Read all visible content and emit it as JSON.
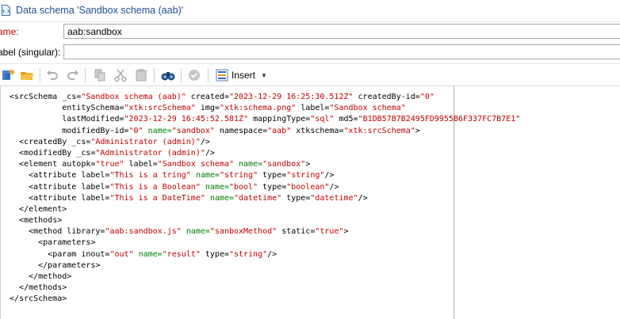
{
  "window": {
    "title": "Data schema 'Sandbox schema (aab)'"
  },
  "form": {
    "name_label": "ame:",
    "name_value": "aab:sandbox",
    "label_label": "abel (singular):",
    "label_value": ""
  },
  "toolbar": {
    "insert_label": "Insert",
    "icons": [
      "new-schema-icon",
      "open-folder-icon",
      "undo-icon",
      "redo-icon",
      "copy-icon",
      "cut-icon",
      "paste-icon",
      "find-icon",
      "check-icon",
      "insert-icon"
    ]
  },
  "colors": {
    "tag": "#000000",
    "attr": "#000000",
    "value": "#c00000",
    "name": "#008000",
    "title": "#1f4f8f",
    "required_label": "#c00000"
  },
  "editor": {
    "lines": [
      {
        "indent": "",
        "parts": [
          [
            "tag",
            "<srcSchema "
          ],
          [
            "attr",
            "_cs="
          ],
          [
            "val",
            "\"Sandbox schema (aab)\""
          ],
          [
            "attr",
            " created="
          ],
          [
            "val",
            "\"2023-12-29 16:25:30.512Z\""
          ],
          [
            "attr",
            " createdBy-id="
          ],
          [
            "val",
            "\"0\""
          ]
        ]
      },
      {
        "indent": "           ",
        "parts": [
          [
            "attr",
            "entitySchema="
          ],
          [
            "val",
            "\"xtk:srcSchema\""
          ],
          [
            "attr",
            " img="
          ],
          [
            "val",
            "\"xtk:schema.png\""
          ],
          [
            "attr",
            " label="
          ],
          [
            "val",
            "\"Sandbox schema\""
          ]
        ]
      },
      {
        "indent": "           ",
        "parts": [
          [
            "attr",
            "lastModified="
          ],
          [
            "val",
            "\"2023-12-29 16:45:52.581Z\""
          ],
          [
            "attr",
            " mappingType="
          ],
          [
            "val",
            "\"sql\""
          ],
          [
            "attr",
            " md5="
          ],
          [
            "val",
            "\"B1DB57B7B2495FD9955B6F337FC7B7E1\""
          ]
        ]
      },
      {
        "indent": "           ",
        "parts": [
          [
            "attr",
            "modifiedBy-id="
          ],
          [
            "val",
            "\"0\""
          ],
          [
            "name",
            " name="
          ],
          [
            "val",
            "\"sandbox\""
          ],
          [
            "attr",
            " namespace="
          ],
          [
            "val",
            "\"aab\""
          ],
          [
            "attr",
            " xtkschema="
          ],
          [
            "val",
            "\"xtk:srcSchema\""
          ],
          [
            "tag",
            ">"
          ]
        ]
      },
      {
        "indent": "  ",
        "parts": [
          [
            "tag",
            "<createdBy "
          ],
          [
            "attr",
            "_cs="
          ],
          [
            "val",
            "\"Administrator (admin)\""
          ],
          [
            "tag",
            "/>"
          ]
        ]
      },
      {
        "indent": "  ",
        "parts": [
          [
            "tag",
            "<modifiedBy "
          ],
          [
            "attr",
            "_cs="
          ],
          [
            "val",
            "\"Administrator (admin)\""
          ],
          [
            "tag",
            "/>"
          ]
        ]
      },
      {
        "indent": "  ",
        "parts": [
          [
            "tag",
            "<element "
          ],
          [
            "attr",
            "autopk="
          ],
          [
            "val",
            "\"true\""
          ],
          [
            "attr",
            " label="
          ],
          [
            "val",
            "\"Sandbox schema\""
          ],
          [
            "name",
            " name="
          ],
          [
            "val",
            "\"sandbox\""
          ],
          [
            "tag",
            ">"
          ]
        ]
      },
      {
        "indent": "    ",
        "parts": [
          [
            "tag",
            "<attribute "
          ],
          [
            "attr",
            "label="
          ],
          [
            "val",
            "\"This is a tring\""
          ],
          [
            "name",
            " name="
          ],
          [
            "val",
            "\"string\""
          ],
          [
            "attr",
            " type="
          ],
          [
            "val",
            "\"string\""
          ],
          [
            "tag",
            "/>"
          ]
        ]
      },
      {
        "indent": "    ",
        "parts": [
          [
            "tag",
            "<attribute "
          ],
          [
            "attr",
            "label="
          ],
          [
            "val",
            "\"This is a Boolean\""
          ],
          [
            "name",
            " name="
          ],
          [
            "val",
            "\"bool\""
          ],
          [
            "attr",
            " type="
          ],
          [
            "val",
            "\"boolean\""
          ],
          [
            "tag",
            "/>"
          ]
        ]
      },
      {
        "indent": "    ",
        "parts": [
          [
            "tag",
            "<attribute "
          ],
          [
            "attr",
            "label="
          ],
          [
            "val",
            "\"This is a DateTime\""
          ],
          [
            "name",
            " name="
          ],
          [
            "val",
            "\"datetime\""
          ],
          [
            "attr",
            " type="
          ],
          [
            "val",
            "\"datetime\""
          ],
          [
            "tag",
            "/>"
          ]
        ]
      },
      {
        "indent": "  ",
        "parts": [
          [
            "tag",
            "</element>"
          ]
        ]
      },
      {
        "indent": "  ",
        "parts": [
          [
            "tag",
            "<methods>"
          ]
        ]
      },
      {
        "indent": "    ",
        "parts": [
          [
            "tag",
            "<method "
          ],
          [
            "attr",
            "library="
          ],
          [
            "val",
            "\"aab:sandbox.js\""
          ],
          [
            "name",
            " name="
          ],
          [
            "val",
            "\"sanboxMethod\""
          ],
          [
            "attr",
            " static="
          ],
          [
            "val",
            "\"true\""
          ],
          [
            "tag",
            ">"
          ]
        ]
      },
      {
        "indent": "      ",
        "parts": [
          [
            "tag",
            "<parameters>"
          ]
        ]
      },
      {
        "indent": "        ",
        "parts": [
          [
            "tag",
            "<param "
          ],
          [
            "attr",
            "inout="
          ],
          [
            "val",
            "\"out\""
          ],
          [
            "name",
            " name="
          ],
          [
            "val",
            "\"result\""
          ],
          [
            "attr",
            " type="
          ],
          [
            "val",
            "\"string\""
          ],
          [
            "tag",
            "/>"
          ]
        ]
      },
      {
        "indent": "      ",
        "parts": [
          [
            "tag",
            "</parameters>"
          ]
        ]
      },
      {
        "indent": "    ",
        "parts": [
          [
            "tag",
            "</method>"
          ]
        ]
      },
      {
        "indent": "  ",
        "parts": [
          [
            "tag",
            "</methods>"
          ]
        ]
      },
      {
        "indent": "",
        "parts": [
          [
            "tag",
            "</srcSchema>"
          ]
        ]
      }
    ]
  }
}
